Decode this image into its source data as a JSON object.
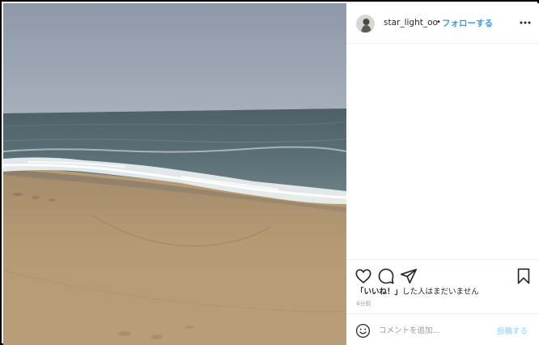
{
  "post": {
    "image_description_icon": "beach-photo",
    "author": {
      "username": "star_light_oo",
      "separator": "•",
      "follow_label": "フォローする"
    },
    "more_icon": "more-horizontal-icon",
    "actions": {
      "like_icon": "heart-icon",
      "comment_icon": "comment-icon",
      "share_icon": "share-icon",
      "save_icon": "bookmark-icon"
    },
    "likes": {
      "quoted": "「いいね！」",
      "rest": "した人はまだいません"
    },
    "timestamp": "4分前",
    "comment_box": {
      "placeholder": "コメントを追加...",
      "post_label": "投稿する",
      "emoji_icon": "emoji-smile-icon"
    }
  },
  "colors": {
    "link_blue": "#3897f0",
    "post_disabled": "#b2dffc",
    "text": "#262626",
    "muted": "#999999",
    "border": "#efefef"
  }
}
